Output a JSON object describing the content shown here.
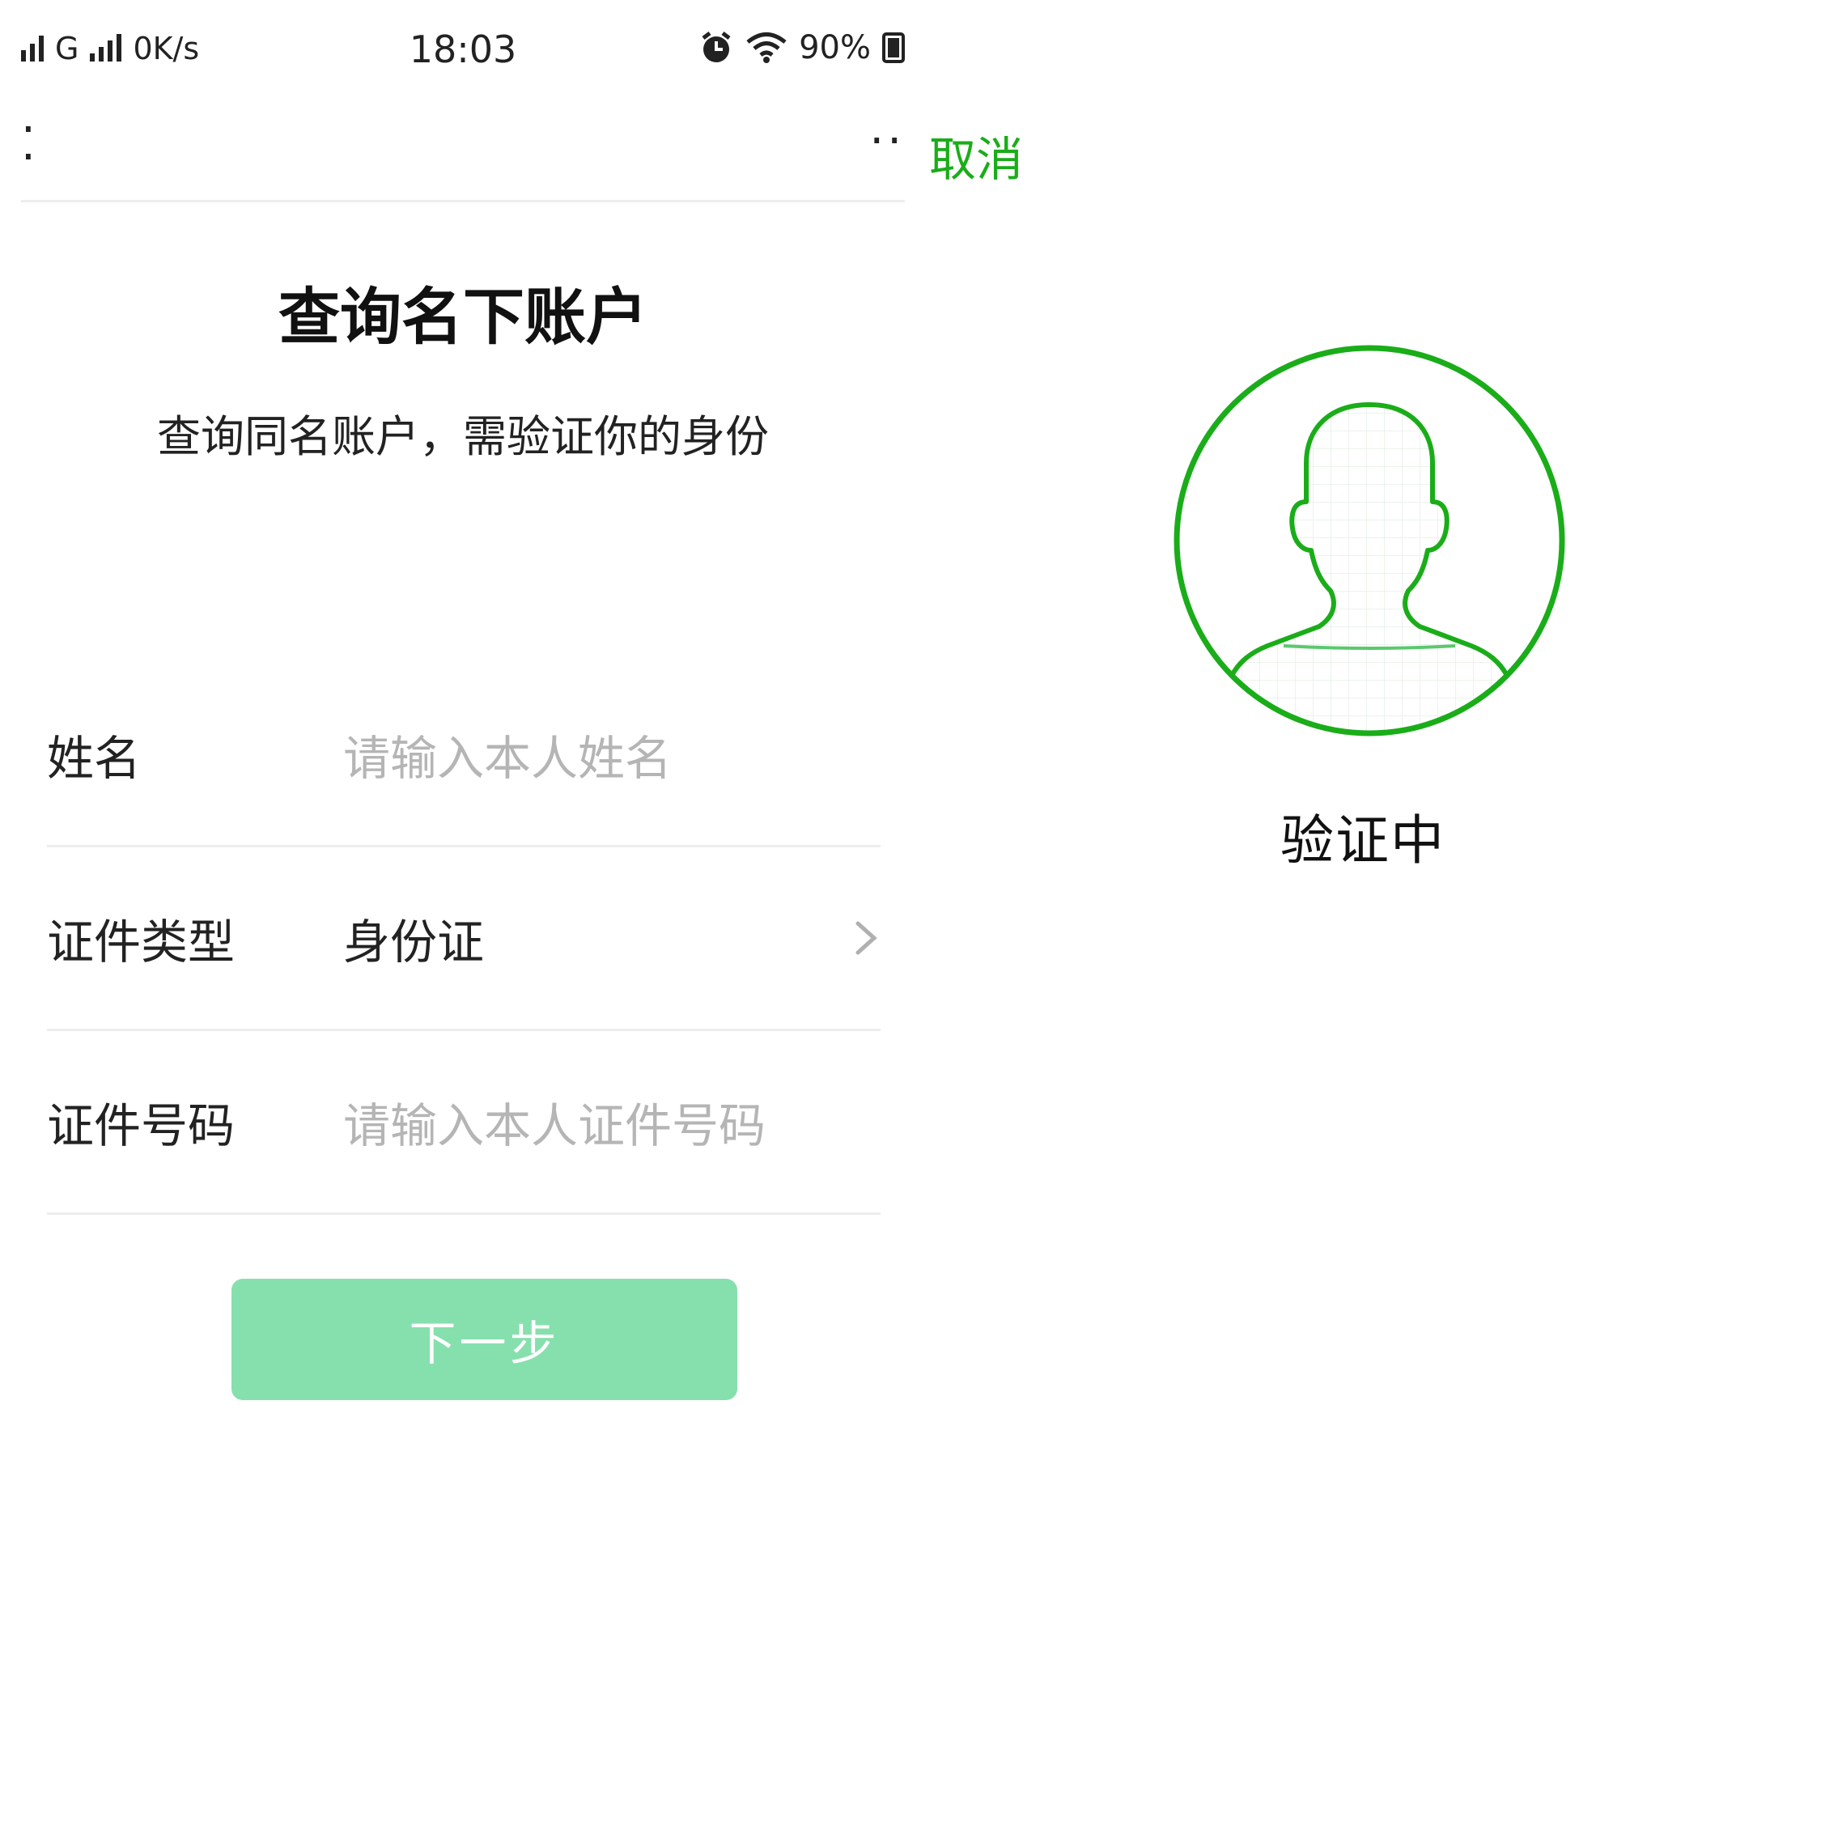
{
  "status_bar": {
    "carrier": "G",
    "net_speed": "0K/s",
    "time": "18:03",
    "battery": "90%",
    "icons": [
      "signal-icon",
      "signal-icon",
      "alarm-icon",
      "wifi-icon",
      "battery-icon"
    ]
  },
  "nav": {
    "more": "··"
  },
  "page": {
    "title": "查询名下账户",
    "subtitle": "查询同名账户，需验证你的身份"
  },
  "form": {
    "name_label": "姓名",
    "name_placeholder": "请输入本人姓名",
    "id_type_label": "证件类型",
    "id_type_value": "身份证",
    "id_number_label": "证件号码",
    "id_number_placeholder": "请输入本人证件号码"
  },
  "next_button": "下一步",
  "verify": {
    "cancel": "取消",
    "status": "验证中"
  },
  "colors": {
    "accent_green": "#1aad19",
    "button_disabled_green": "#86e0ad",
    "placeholder_gray": "#b5b5b5"
  }
}
